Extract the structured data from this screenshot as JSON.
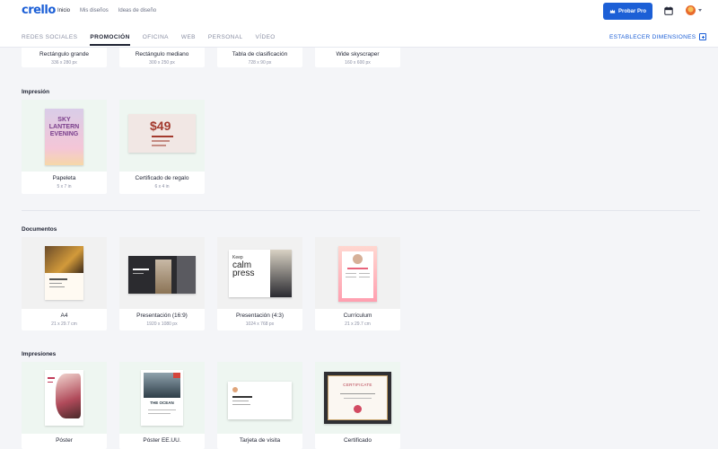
{
  "app": {
    "logo": "crello"
  },
  "nav": [
    "Inicio",
    "Mis diseños",
    "Ideas de diseño"
  ],
  "pro_button": "Probar Pro",
  "tabs": [
    "REDES SOCIALES",
    "PROMOCIÓN",
    "OFICINA",
    "WEB",
    "PERSONAL",
    "VÍDEO"
  ],
  "set_dimensions": "ESTABLECER DIMENSIONES",
  "top_cards": [
    {
      "label": "Rectángulo grande",
      "size": "336 x 280 px"
    },
    {
      "label": "Rectángulo mediano",
      "size": "300 x 250 px"
    },
    {
      "label": "Tabla de clasificación",
      "size": "728 x 90 px"
    },
    {
      "label": "Wide skyscraper",
      "size": "160 x 600 px"
    }
  ],
  "sections": {
    "impresion": {
      "title": "Impresión",
      "cards": [
        {
          "label": "Papeleta",
          "size": "5 x 7 in",
          "thumb_text": [
            "SKY",
            "LANTERN",
            "EVENING"
          ]
        },
        {
          "label": "Certificado de regalo",
          "size": "6 x 4 in",
          "thumb_text": [
            "$49"
          ]
        }
      ]
    },
    "documentos": {
      "title": "Documentos",
      "cards": [
        {
          "label": "A4",
          "size": "21 x 29.7 cm"
        },
        {
          "label": "Presentación (16:9)",
          "size": "1920 x 1080 px"
        },
        {
          "label": "Presentación (4:3)",
          "size": "1024 x 768 px",
          "thumb_text": [
            "Keep",
            "calm",
            "press"
          ]
        },
        {
          "label": "Currículum",
          "size": "21 x 29.7 cm"
        }
      ]
    },
    "impresiones": {
      "title": "Impresiones",
      "cards": [
        {
          "label": "Póster",
          "size": ""
        },
        {
          "label": "Póster EE.UU.",
          "size": "",
          "thumb_text": [
            "THE OCEAN"
          ]
        },
        {
          "label": "Tarjeta de visita",
          "size": ""
        },
        {
          "label": "Certificado",
          "size": "",
          "thumb_text": [
            "CERTIFICATE"
          ]
        }
      ]
    }
  }
}
